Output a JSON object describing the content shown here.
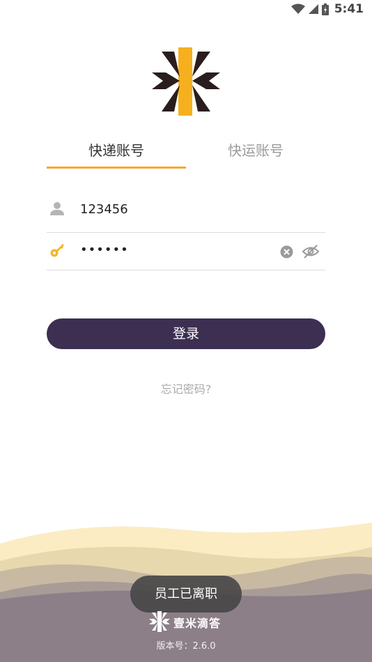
{
  "status_bar": {
    "time": "5:41"
  },
  "tabs": [
    {
      "label": "快递账号",
      "active": true
    },
    {
      "label": "快运账号",
      "active": false
    }
  ],
  "form": {
    "username_value": "123456",
    "password_value": "••••••"
  },
  "login_button": {
    "label": "登录"
  },
  "forgot_link": {
    "label": "忘记密码?"
  },
  "toast": {
    "text": "员工已离职"
  },
  "footer": {
    "brand": "壹米滴答",
    "version": "版本号：2.6.0"
  },
  "colors": {
    "accent": "#f5a92f",
    "button": "#3d2f52",
    "logo_dark": "#2a1d1d",
    "logo_yellow": "#f6b01e"
  }
}
